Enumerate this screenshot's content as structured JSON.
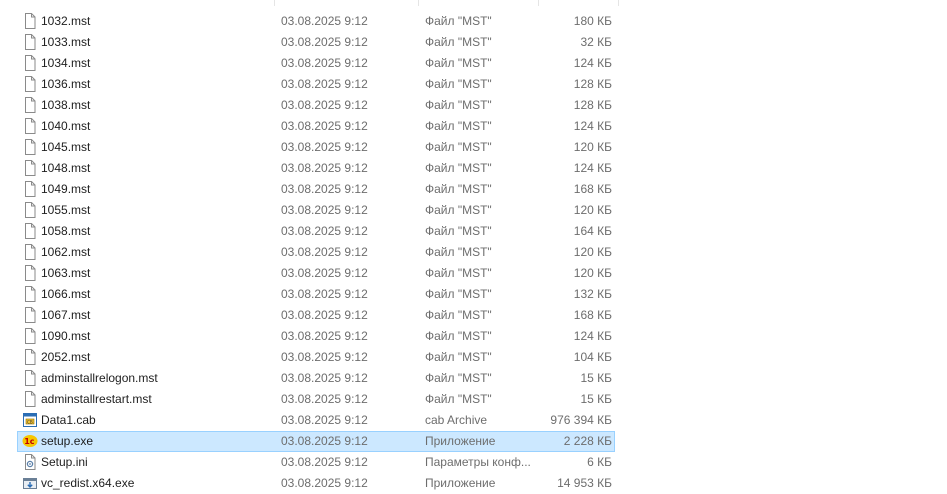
{
  "files": [
    {
      "name": "1032.mst",
      "date": "03.08.2025 9:12",
      "type": "Файл \"MST\"",
      "size": "180 КБ",
      "icon": "document-icon"
    },
    {
      "name": "1033.mst",
      "date": "03.08.2025 9:12",
      "type": "Файл \"MST\"",
      "size": "32 КБ",
      "icon": "document-icon"
    },
    {
      "name": "1034.mst",
      "date": "03.08.2025 9:12",
      "type": "Файл \"MST\"",
      "size": "124 КБ",
      "icon": "document-icon"
    },
    {
      "name": "1036.mst",
      "date": "03.08.2025 9:12",
      "type": "Файл \"MST\"",
      "size": "128 КБ",
      "icon": "document-icon"
    },
    {
      "name": "1038.mst",
      "date": "03.08.2025 9:12",
      "type": "Файл \"MST\"",
      "size": "128 КБ",
      "icon": "document-icon"
    },
    {
      "name": "1040.mst",
      "date": "03.08.2025 9:12",
      "type": "Файл \"MST\"",
      "size": "124 КБ",
      "icon": "document-icon"
    },
    {
      "name": "1045.mst",
      "date": "03.08.2025 9:12",
      "type": "Файл \"MST\"",
      "size": "120 КБ",
      "icon": "document-icon"
    },
    {
      "name": "1048.mst",
      "date": "03.08.2025 9:12",
      "type": "Файл \"MST\"",
      "size": "124 КБ",
      "icon": "document-icon"
    },
    {
      "name": "1049.mst",
      "date": "03.08.2025 9:12",
      "type": "Файл \"MST\"",
      "size": "168 КБ",
      "icon": "document-icon"
    },
    {
      "name": "1055.mst",
      "date": "03.08.2025 9:12",
      "type": "Файл \"MST\"",
      "size": "120 КБ",
      "icon": "document-icon"
    },
    {
      "name": "1058.mst",
      "date": "03.08.2025 9:12",
      "type": "Файл \"MST\"",
      "size": "164 КБ",
      "icon": "document-icon"
    },
    {
      "name": "1062.mst",
      "date": "03.08.2025 9:12",
      "type": "Файл \"MST\"",
      "size": "120 КБ",
      "icon": "document-icon"
    },
    {
      "name": "1063.mst",
      "date": "03.08.2025 9:12",
      "type": "Файл \"MST\"",
      "size": "120 КБ",
      "icon": "document-icon"
    },
    {
      "name": "1066.mst",
      "date": "03.08.2025 9:12",
      "type": "Файл \"MST\"",
      "size": "132 КБ",
      "icon": "document-icon"
    },
    {
      "name": "1067.mst",
      "date": "03.08.2025 9:12",
      "type": "Файл \"MST\"",
      "size": "168 КБ",
      "icon": "document-icon"
    },
    {
      "name": "1090.mst",
      "date": "03.08.2025 9:12",
      "type": "Файл \"MST\"",
      "size": "124 КБ",
      "icon": "document-icon"
    },
    {
      "name": "2052.mst",
      "date": "03.08.2025 9:12",
      "type": "Файл \"MST\"",
      "size": "104 КБ",
      "icon": "document-icon"
    },
    {
      "name": "adminstallrelogon.mst",
      "date": "03.08.2025 9:12",
      "type": "Файл \"MST\"",
      "size": "15 КБ",
      "icon": "document-icon"
    },
    {
      "name": "adminstallrestart.mst",
      "date": "03.08.2025 9:12",
      "type": "Файл \"MST\"",
      "size": "15 КБ",
      "icon": "document-icon"
    },
    {
      "name": "Data1.cab",
      "date": "03.08.2025 9:12",
      "type": "cab Archive",
      "size": "976 394 КБ",
      "icon": "cab-archive-icon"
    },
    {
      "name": "setup.exe",
      "date": "03.08.2025 9:12",
      "type": "Приложение",
      "size": "2 228 КБ",
      "icon": "1c-app-icon",
      "selected": true
    },
    {
      "name": "Setup.ini",
      "date": "03.08.2025 9:12",
      "type": "Параметры конф...",
      "size": "6 КБ",
      "icon": "settings-file-icon"
    },
    {
      "name": "vc_redist.x64.exe",
      "date": "03.08.2025 9:12",
      "type": "Приложение",
      "size": "14 953 КБ",
      "icon": "installer-icon"
    }
  ],
  "colors": {
    "selection_bg": "#cce8ff",
    "selection_border": "#99d1ff",
    "secondary_text": "#6d6d6d",
    "1c_logo": "#f7c600"
  }
}
